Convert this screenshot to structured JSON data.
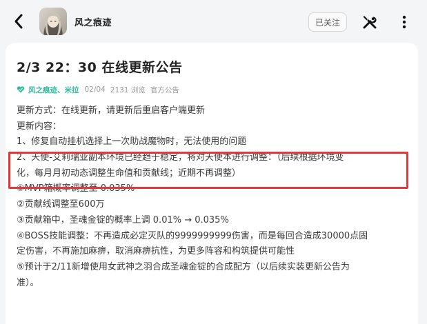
{
  "header": {
    "author_name": "风之痕迹",
    "follow_label": "已关注"
  },
  "post": {
    "title": "2/3 22：30 在线更新公告",
    "meta": {
      "tags": "风之痕迹、米拉",
      "date": "02/04",
      "views": "2131 浏览",
      "category": "官方公告"
    },
    "lines": [
      "更新方式：在线更新，请更新后重启客户端更新",
      "更新内容：",
      "1、修复自动挂机选择上一次助战魔物时，无法使用的问题",
      "2、天使-艾莉瑞亚副本环境已经趋于稳定，将对天使本进行调整：（后续根据环境变",
      "化，每月月初动态调整生命值和贡献线；近期不再调整）",
      "①MVP箱概率调整至 0.035%",
      "②贡献线调整至600万",
      "③贡献箱中，圣魂金锭的概率上调 0.01% → 0.035%",
      "④BOSS技能调整：不再造成必定灭队的9999999999伤害，而是每回合造成30000点固",
      "定伤害，不再施加麻痹，取消麻痹抗性，为更多阵容和构筑提供可能性",
      "⑤预计于2/11新增使用女武神之羽合成圣魂金锭的合成配方（以后续实装更新公告为",
      "准）。"
    ]
  },
  "colors": {
    "accent_green": "#2dbd9c",
    "highlight_red": "#e0393a"
  },
  "icons": {
    "back": "chevron-left-icon",
    "tools": "wrench-screwdriver-icon",
    "more": "more-vertical-icon",
    "tag": "heart-icon"
  }
}
